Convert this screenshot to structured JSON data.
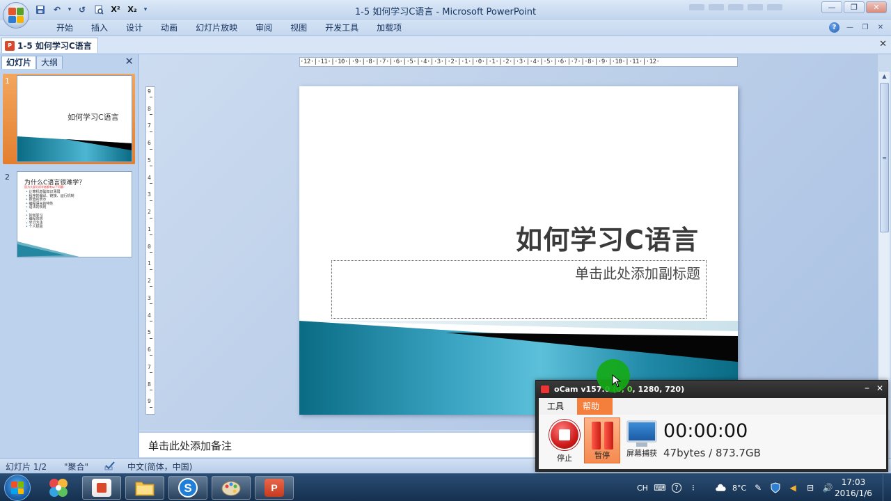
{
  "window": {
    "title": "1-5 如何学习C语言 - Microsoft PowerPoint",
    "controls": [
      "—",
      "❐",
      "✕"
    ]
  },
  "qat": {
    "undo_icon": "↶",
    "redo_icon": "↺",
    "preview_icon": "🔍",
    "superscript": "X²",
    "subscript": "X₂",
    "dropdown": "▾"
  },
  "ribbon": {
    "tabs": [
      "开始",
      "插入",
      "设计",
      "动画",
      "幻灯片放映",
      "审阅",
      "视图",
      "开发工具",
      "加载项"
    ],
    "help": "?",
    "min": "—",
    "restore": "❐",
    "close": "✕"
  },
  "doc_tab": {
    "label": "1-5 如何学习C语言",
    "close": "✕"
  },
  "left_panel": {
    "tabs": [
      "幻灯片",
      "大纲"
    ],
    "close": "✕",
    "slides": [
      {
        "num": "1",
        "title": "如何学习C语言"
      },
      {
        "num": "2",
        "title": "为什么C语言很难学？",
        "subtitle": "因为大部分初学者都有以下问题：",
        "bullets": [
          "计算机基础知识薄弱",
          "程序的编译、链接、运行机制",
          "数值的表示",
          "编程语言的特性",
          "语法的规则",
          " ",
          "如何学习",
          "编程思想",
          "学习方法",
          "个人经验"
        ]
      }
    ]
  },
  "ruler": {
    "horizontal": "·12·|·11·|·10·|·9·|·8·|·7·|·6·|·5·|·4·|·3·|·2·|·1·|·0·|·1·|·2·|·3·|·4·|·5·|·6·|·7·|·8·|·9·|·10·|·11·|·12·",
    "vertical": [
      "9",
      "8",
      "7",
      "6",
      "5",
      "4",
      "3",
      "2",
      "1",
      "0",
      "1",
      "2",
      "3",
      "4",
      "5",
      "6",
      "7",
      "8",
      "9"
    ]
  },
  "slide": {
    "title": "如何学习C语言",
    "subtitle_placeholder": "单击此处添加副标题"
  },
  "notes": {
    "placeholder": "单击此处添加备注"
  },
  "status": {
    "slide_count": "幻灯片 1/2",
    "theme": "\"聚合\"",
    "language": "中文(简体，中国)"
  },
  "ocam": {
    "title_prefix": "oCam v157.0 ",
    "title_coords": "(0, 0",
    "title_suffix": ", 1280, 720)",
    "menu": [
      "工具",
      "帮助"
    ],
    "stop_label": "停止",
    "pause_label": "暂停",
    "capture_label": "屏幕捕获",
    "timer": "00:00:00",
    "size": "47bytes / 873.7GB",
    "minimize": "–",
    "close": "✕"
  },
  "taskbar": {
    "tray_text": "CH",
    "temperature": "8°C",
    "time": "17:03",
    "date": "2016/1/6"
  },
  "colors": {
    "teal_dark": "#0a6b84",
    "teal_light": "#4db6d2",
    "ocam_accent": "#f47f3c"
  }
}
